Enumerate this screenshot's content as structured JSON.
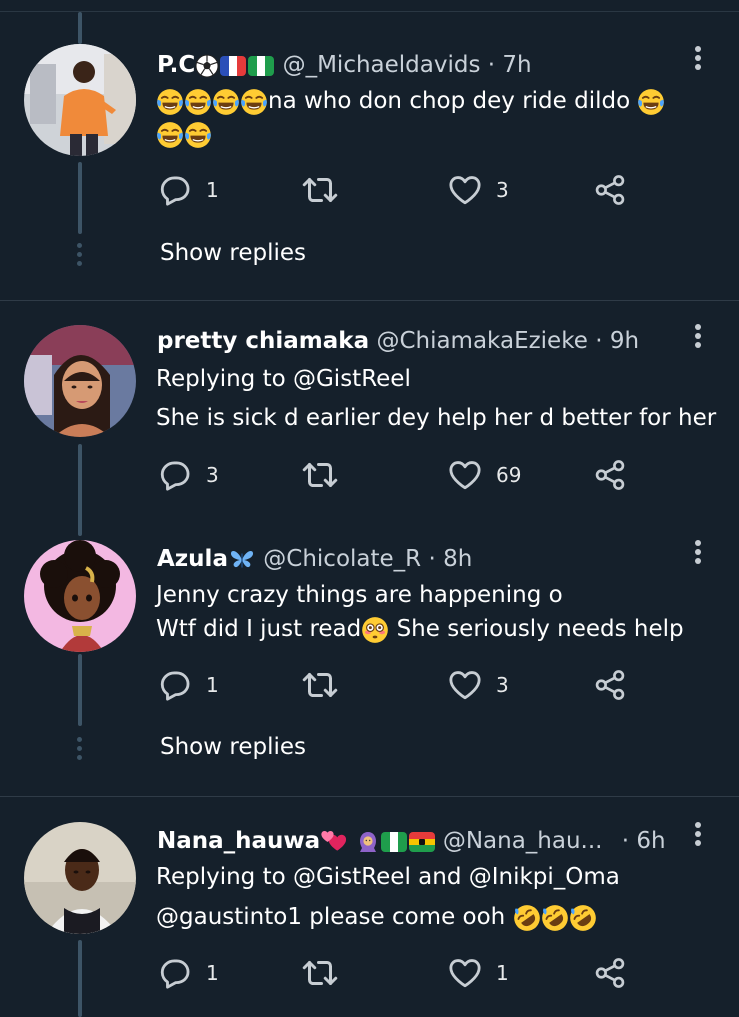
{
  "tweets": [
    {
      "name": "P.C",
      "handle": "@_Michaeldavids",
      "sep": "·",
      "time": "7h",
      "line1": "na who don chop dey ride dildo",
      "replies": "1",
      "likes": "3",
      "show_replies": "Show replies"
    },
    {
      "name": "pretty chiamaka",
      "handle": "@ChiamakaEzieke",
      "sep": "·",
      "time": "9h",
      "replying": "Replying to @GistReel",
      "line1": "She is sick d earlier dey help her d better for her",
      "replies": "3",
      "likes": "69"
    },
    {
      "name": "Azula",
      "handle": "@Chicolate_R",
      "sep": "·",
      "time": "8h",
      "line1": "Jenny crazy things are happening o",
      "line2a": "Wtf did I just read",
      "line2b": "She seriously needs help",
      "replies": "1",
      "likes": "3",
      "show_replies": "Show replies"
    },
    {
      "name": "Nana_hauwa",
      "handle": "@Nana_hau...",
      "sep": "·",
      "time": "6h",
      "replying": "Replying to @GistReel and @Inikpi_Oma",
      "line1": "@gaustinto1 please come ooh",
      "replies": "1",
      "likes": "1"
    }
  ],
  "colors": {
    "background": "#15202b",
    "thread_line": "#3d5466",
    "icon": "#c7cdd3"
  },
  "icons": [
    "reply-icon",
    "retweet-icon",
    "like-icon",
    "share-icon",
    "more-icon",
    "soccer-ball-icon",
    "france-flag-icon",
    "nigeria-flag-icon",
    "ghana-flag-icon",
    "laughing-tears-emoji",
    "flushed-face-emoji",
    "rolling-laughing-emoji",
    "butterfly-emoji",
    "hearts-emoji",
    "woman-hijab-emoji"
  ]
}
